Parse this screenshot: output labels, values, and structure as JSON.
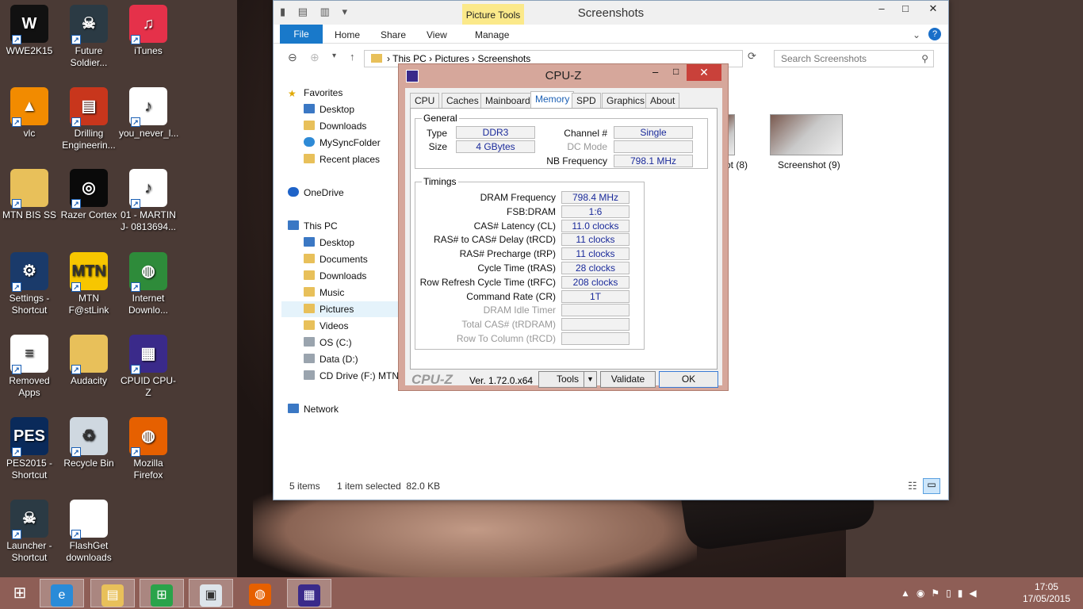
{
  "desktop": {
    "icons": [
      {
        "label": "WWE2K15",
        "icon": "wwe-icon",
        "color": "#111111"
      },
      {
        "label": "Future Soldier...",
        "icon": "soldier-icon",
        "color": "#2b3a44"
      },
      {
        "label": "iTunes",
        "icon": "itunes-icon",
        "color": "#e5314a"
      },
      {
        "label": "vlc",
        "icon": "vlc-cone-icon",
        "color": "#f28b00"
      },
      {
        "label": "Drilling Engineerin...",
        "icon": "pdf-document-icon",
        "color": "#c8361c"
      },
      {
        "label": "you_never_l...",
        "icon": "mp3-file-icon",
        "color": "#ffffff"
      },
      {
        "label": "MTN BIS SS",
        "icon": "folder-icon",
        "color": "#e8c05a"
      },
      {
        "label": "Razer Cortex",
        "icon": "razer-icon",
        "color": "#0a0a0a"
      },
      {
        "label": "01 - MARTIN J- 0813694...",
        "icon": "mp3-file-icon",
        "color": "#ffffff"
      },
      {
        "label": "Settings - Shortcut",
        "icon": "pes-settings-icon",
        "color": "#1a3a6a"
      },
      {
        "label": "MTN F@stLink",
        "icon": "mtn-icon",
        "color": "#f7c600"
      },
      {
        "label": "Internet Downlo...",
        "icon": "idm-globe-icon",
        "color": "#2e8b3a"
      },
      {
        "label": "Removed Apps",
        "icon": "text-file-icon",
        "color": "#ffffff"
      },
      {
        "label": "Audacity",
        "icon": "folder-icon",
        "color": "#e8c05a"
      },
      {
        "label": "CPUID CPU-Z",
        "icon": "cpuz-icon",
        "color": "#3a2a8a"
      },
      {
        "label": "PES2015 - Shortcut",
        "icon": "pes-icon",
        "color": "#0a2a5a"
      },
      {
        "label": "Recycle Bin",
        "icon": "recycle-bin-icon",
        "color": "#cfd8e0"
      },
      {
        "label": "Mozilla Firefox",
        "icon": "firefox-icon",
        "color": "#e66000"
      },
      {
        "label": "Launcher - Shortcut",
        "icon": "soldier-icon",
        "color": "#2b3a44"
      },
      {
        "label": "FlashGet downloads",
        "icon": "blank-file-icon",
        "color": "#ffffff"
      }
    ]
  },
  "explorer": {
    "title": "Screenshots",
    "context_tab": "Picture Tools",
    "ribbon_tabs": [
      "File",
      "Home",
      "Share",
      "View",
      "Manage"
    ],
    "breadcrumb": [
      "This PC",
      "Pictures",
      "Screenshots"
    ],
    "search_placeholder": "Search Screenshots",
    "nav": [
      {
        "label": "Favorites",
        "icon": "star-icon"
      },
      {
        "label": "Desktop",
        "icon": "desktop-icon"
      },
      {
        "label": "Downloads",
        "icon": "downloads-folder-icon"
      },
      {
        "label": "MySyncFolder",
        "icon": "sync-icon"
      },
      {
        "label": "Recent places",
        "icon": "recent-places-icon"
      },
      {
        "label": "OneDrive",
        "icon": "onedrive-cloud-icon"
      },
      {
        "label": "This PC",
        "icon": "computer-icon"
      },
      {
        "label": "Desktop",
        "icon": "desktop-icon"
      },
      {
        "label": "Documents",
        "icon": "documents-folder-icon"
      },
      {
        "label": "Downloads",
        "icon": "downloads-folder-icon"
      },
      {
        "label": "Music",
        "icon": "music-folder-icon"
      },
      {
        "label": "Pictures",
        "icon": "pictures-folder-icon"
      },
      {
        "label": "Videos",
        "icon": "videos-folder-icon"
      },
      {
        "label": "OS (C:)",
        "icon": "drive-icon"
      },
      {
        "label": "Data (D:)",
        "icon": "drive-icon"
      },
      {
        "label": "CD Drive (F:) MTN",
        "icon": "cd-drive-icon"
      },
      {
        "label": "Network",
        "icon": "network-icon"
      }
    ],
    "thumb_labels": [
      "ot (8)",
      "Screenshot (9)"
    ],
    "status_items": "5 items",
    "status_selected": "1 item selected  82.0 KB"
  },
  "cpuz": {
    "title": "CPU-Z",
    "tabs": [
      "CPU",
      "Caches",
      "Mainboard",
      "Memory",
      "SPD",
      "Graphics",
      "About"
    ],
    "active_tab": "Memory",
    "general": {
      "title": "General",
      "type_label": "Type",
      "type_value": "DDR3",
      "size_label": "Size",
      "size_value": "4 GBytes",
      "channel_label": "Channel #",
      "channel_value": "Single",
      "dcmode_label": "DC Mode",
      "dcmode_value": "",
      "nbfreq_label": "NB Frequency",
      "nbfreq_value": "798.1 MHz"
    },
    "timings": {
      "title": "Timings",
      "rows": [
        {
          "label": "DRAM Frequency",
          "value": "798.4 MHz"
        },
        {
          "label": "FSB:DRAM",
          "value": "1:6"
        },
        {
          "label": "CAS# Latency (CL)",
          "value": "11.0 clocks"
        },
        {
          "label": "RAS# to CAS# Delay (tRCD)",
          "value": "11 clocks"
        },
        {
          "label": "RAS# Precharge (tRP)",
          "value": "11 clocks"
        },
        {
          "label": "Cycle Time (tRAS)",
          "value": "28 clocks"
        },
        {
          "label": "Row Refresh Cycle Time (tRFC)",
          "value": "208 clocks"
        },
        {
          "label": "Command Rate (CR)",
          "value": "1T"
        },
        {
          "label": "DRAM Idle Timer",
          "value": ""
        },
        {
          "label": "Total CAS# (tRDRAM)",
          "value": ""
        },
        {
          "label": "Row To Column (tRCD)",
          "value": ""
        }
      ]
    },
    "logo": "CPU-Z",
    "version": "Ver. 1.72.0.x64",
    "tools_label": "Tools",
    "validate_label": "Validate",
    "ok_label": "OK"
  },
  "taskbar": {
    "items": [
      {
        "icon": "start-windows-icon"
      },
      {
        "icon": "internet-explorer-icon"
      },
      {
        "icon": "file-explorer-icon"
      },
      {
        "icon": "windows-store-icon"
      },
      {
        "icon": "app-window-icon"
      },
      {
        "icon": "firefox-icon"
      },
      {
        "icon": "cpuz-icon"
      }
    ],
    "time": "17:05",
    "date": "17/05/2015"
  }
}
